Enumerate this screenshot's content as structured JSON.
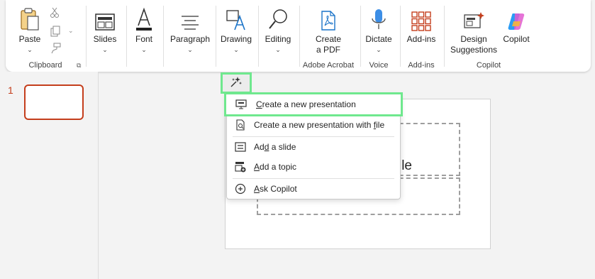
{
  "ribbon": {
    "clipboard": {
      "paste_label": "Paste",
      "group_label": "Clipboard"
    },
    "slides_label": "Slides",
    "font_label": "Font",
    "paragraph_label": "Paragraph",
    "drawing_label": "Drawing",
    "editing_label": "Editing",
    "adobe": {
      "create_pdf_line1": "Create",
      "create_pdf_line2": "a PDF",
      "group_label": "Adobe Acrobat"
    },
    "voice": {
      "dictate_label": "Dictate",
      "group_label": "Voice"
    },
    "addins": {
      "addins_label": "Add-ins",
      "group_label": "Add-ins"
    },
    "copilot": {
      "design_line1": "Design",
      "design_line2": "Suggestions",
      "copilot_label": "Copilot",
      "group_label": "Copilot"
    }
  },
  "thumbnails": {
    "slide_number": "1"
  },
  "slide": {
    "title_fragment": "le"
  },
  "menu": {
    "items": [
      {
        "pre": "",
        "key": "C",
        "post": "reate a new presentation"
      },
      {
        "pre": "Create a new presentation with ",
        "key": "f",
        "post": "ile"
      },
      {
        "pre": "Ad",
        "key": "d",
        "post": " a slide"
      },
      {
        "pre": "",
        "key": "A",
        "post": "dd a topic"
      },
      {
        "pre": "",
        "key": "A",
        "post": "sk Copilot"
      }
    ]
  },
  "colors": {
    "accent": "#c43e1c",
    "highlight": "#6fe88e"
  },
  "icons": [
    "paste-icon",
    "cut-icon",
    "copy-icon",
    "format-painter-icon",
    "slides-icon",
    "font-icon",
    "paragraph-icon",
    "drawing-icon",
    "search-icon",
    "create-pdf-icon",
    "microphone-icon",
    "addins-icon",
    "design-suggestions-icon",
    "copilot-icon",
    "sparkle-icon",
    "presentation-icon",
    "file-search-icon",
    "slide-add-icon",
    "topic-add-icon",
    "copilot-chat-icon"
  ]
}
